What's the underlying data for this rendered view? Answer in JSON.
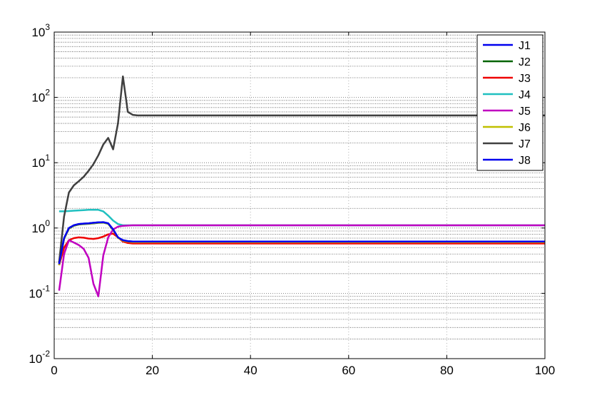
{
  "chart_data": {
    "type": "line",
    "title": "",
    "xlabel": "",
    "ylabel": "",
    "xlim": [
      0,
      100
    ],
    "ylim": [
      0.01,
      1000
    ],
    "yscale": "log",
    "grid": true,
    "legend_position": "top-right",
    "x_ticks": [
      "0",
      "20",
      "40",
      "60",
      "80",
      "100"
    ],
    "y_tick_labels": [
      {
        "base": "10",
        "exp": "-2"
      },
      {
        "base": "10",
        "exp": "-1"
      },
      {
        "base": "10",
        "exp": "0"
      },
      {
        "base": "10",
        "exp": "1"
      },
      {
        "base": "10",
        "exp": "2"
      },
      {
        "base": "10",
        "exp": "3"
      }
    ],
    "series": [
      {
        "name": "J1",
        "color": "#0000ee",
        "points": [
          [
            1,
            0.28
          ],
          [
            2,
            0.7
          ],
          [
            3,
            1.0
          ],
          [
            4,
            1.1
          ],
          [
            5,
            1.15
          ],
          [
            6,
            1.17
          ],
          [
            7,
            1.18
          ],
          [
            8,
            1.2
          ],
          [
            9,
            1.22
          ],
          [
            10,
            1.23
          ],
          [
            11,
            1.18
          ],
          [
            12,
            0.95
          ],
          [
            13,
            0.72
          ],
          [
            14,
            0.65
          ],
          [
            15,
            0.63
          ],
          [
            16,
            0.62
          ],
          [
            18,
            0.62
          ],
          [
            20,
            0.62
          ],
          [
            40,
            0.62
          ],
          [
            60,
            0.62
          ],
          [
            80,
            0.62
          ],
          [
            100,
            0.62
          ]
        ]
      },
      {
        "name": "J2",
        "color": "#006400",
        "points": [
          [
            1,
            0.27
          ],
          [
            2,
            0.68
          ],
          [
            3,
            0.98
          ],
          [
            4,
            1.08
          ],
          [
            5,
            1.13
          ],
          [
            6,
            1.15
          ],
          [
            7,
            1.16
          ],
          [
            8,
            1.18
          ],
          [
            9,
            1.2
          ],
          [
            10,
            1.21
          ],
          [
            11,
            1.16
          ],
          [
            12,
            0.93
          ],
          [
            13,
            0.71
          ],
          [
            14,
            0.64
          ],
          [
            15,
            0.62
          ],
          [
            16,
            0.61
          ],
          [
            18,
            0.61
          ],
          [
            20,
            0.61
          ],
          [
            40,
            0.61
          ],
          [
            60,
            0.61
          ],
          [
            80,
            0.61
          ],
          [
            100,
            0.61
          ]
        ]
      },
      {
        "name": "J3",
        "color": "#ee0000",
        "points": [
          [
            1,
            0.27
          ],
          [
            2,
            0.5
          ],
          [
            3,
            0.65
          ],
          [
            4,
            0.7
          ],
          [
            5,
            0.72
          ],
          [
            6,
            0.71
          ],
          [
            7,
            0.69
          ],
          [
            8,
            0.68
          ],
          [
            9,
            0.7
          ],
          [
            10,
            0.74
          ],
          [
            11,
            0.8
          ],
          [
            12,
            0.82
          ],
          [
            13,
            0.72
          ],
          [
            14,
            0.62
          ],
          [
            15,
            0.59
          ],
          [
            16,
            0.58
          ],
          [
            18,
            0.58
          ],
          [
            20,
            0.58
          ],
          [
            40,
            0.58
          ],
          [
            60,
            0.58
          ],
          [
            80,
            0.58
          ],
          [
            100,
            0.58
          ]
        ]
      },
      {
        "name": "J4",
        "color": "#20c0c0",
        "points": [
          [
            1,
            1.8
          ],
          [
            2,
            1.8
          ],
          [
            3,
            1.82
          ],
          [
            4,
            1.84
          ],
          [
            5,
            1.86
          ],
          [
            6,
            1.88
          ],
          [
            7,
            1.9
          ],
          [
            8,
            1.9
          ],
          [
            9,
            1.9
          ],
          [
            10,
            1.8
          ],
          [
            11,
            1.55
          ],
          [
            12,
            1.3
          ],
          [
            13,
            1.15
          ],
          [
            14,
            1.1
          ],
          [
            15,
            1.1
          ],
          [
            16,
            1.1
          ],
          [
            20,
            1.1
          ],
          [
            40,
            1.1
          ],
          [
            60,
            1.1
          ],
          [
            80,
            1.1
          ],
          [
            100,
            1.1
          ]
        ]
      },
      {
        "name": "J5",
        "color": "#c000c0",
        "points": [
          [
            1,
            0.11
          ],
          [
            2,
            0.4
          ],
          [
            3,
            0.65
          ],
          [
            4,
            0.6
          ],
          [
            5,
            0.55
          ],
          [
            6,
            0.48
          ],
          [
            7,
            0.35
          ],
          [
            8,
            0.14
          ],
          [
            9,
            0.09
          ],
          [
            10,
            0.38
          ],
          [
            11,
            0.72
          ],
          [
            12,
            0.95
          ],
          [
            13,
            1.05
          ],
          [
            14,
            1.08
          ],
          [
            15,
            1.09
          ],
          [
            16,
            1.1
          ],
          [
            20,
            1.1
          ],
          [
            40,
            1.1
          ],
          [
            60,
            1.1
          ],
          [
            80,
            1.1
          ],
          [
            100,
            1.1
          ]
        ]
      },
      {
        "name": "J6",
        "color": "#c0c000",
        "points": [
          [
            1,
            0.27
          ],
          [
            2,
            0.69
          ],
          [
            3,
            0.99
          ],
          [
            4,
            1.09
          ],
          [
            5,
            1.14
          ],
          [
            6,
            1.16
          ],
          [
            7,
            1.17
          ],
          [
            8,
            1.19
          ],
          [
            9,
            1.21
          ],
          [
            10,
            1.22
          ],
          [
            11,
            1.17
          ],
          [
            12,
            0.94
          ],
          [
            13,
            0.71
          ],
          [
            14,
            0.64
          ],
          [
            15,
            0.62
          ],
          [
            16,
            0.61
          ],
          [
            20,
            0.61
          ],
          [
            40,
            0.61
          ],
          [
            60,
            0.61
          ],
          [
            80,
            0.61
          ],
          [
            100,
            0.61
          ]
        ]
      },
      {
        "name": "J7",
        "color": "#404040",
        "points": [
          [
            1,
            0.3
          ],
          [
            2,
            1.5
          ],
          [
            3,
            3.5
          ],
          [
            4,
            4.5
          ],
          [
            5,
            5.2
          ],
          [
            6,
            6.1
          ],
          [
            7,
            7.5
          ],
          [
            8,
            9.5
          ],
          [
            9,
            13
          ],
          [
            10,
            19
          ],
          [
            11,
            24
          ],
          [
            12,
            16
          ],
          [
            13,
            40
          ],
          [
            14,
            210
          ],
          [
            15,
            60
          ],
          [
            16,
            54
          ],
          [
            17,
            53
          ],
          [
            18,
            53
          ],
          [
            20,
            53
          ],
          [
            40,
            53
          ],
          [
            60,
            53
          ],
          [
            80,
            53
          ],
          [
            100,
            53
          ]
        ]
      },
      {
        "name": "J8",
        "color": "#0000ee",
        "points": [
          [
            1,
            0.28
          ],
          [
            2,
            0.7
          ],
          [
            3,
            1.0
          ],
          [
            4,
            1.1
          ],
          [
            5,
            1.15
          ],
          [
            6,
            1.17
          ],
          [
            7,
            1.18
          ],
          [
            8,
            1.2
          ],
          [
            9,
            1.22
          ],
          [
            10,
            1.23
          ],
          [
            11,
            1.18
          ],
          [
            12,
            0.95
          ],
          [
            13,
            0.72
          ],
          [
            14,
            0.65
          ],
          [
            15,
            0.63
          ],
          [
            16,
            0.62
          ],
          [
            20,
            0.62
          ],
          [
            40,
            0.62
          ],
          [
            60,
            0.62
          ],
          [
            80,
            0.62
          ],
          [
            100,
            0.62
          ]
        ]
      }
    ]
  }
}
